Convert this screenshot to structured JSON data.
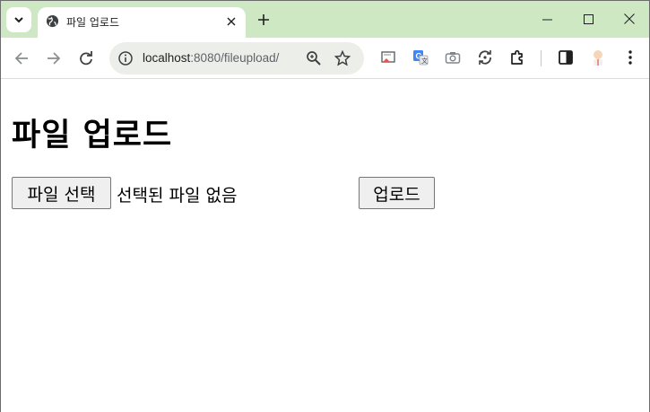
{
  "window": {
    "tab_title": "파일 업로드",
    "new_tab_glyph": "+",
    "frame_color": "#cfe8c4"
  },
  "toolbar": {
    "url_host": "localhost",
    "url_path": ":8080/fileupload/",
    "icons": [
      "back-icon",
      "forward-icon",
      "reload-icon",
      "info-icon",
      "zoom-icon",
      "star-icon",
      "cast-icon",
      "translate-icon",
      "camera-icon",
      "sync-icon",
      "extensions-icon",
      "side-panel-icon",
      "profile-avatar",
      "kebab-menu-icon"
    ]
  },
  "page": {
    "heading": "파일 업로드",
    "choose_file_label": "파일 선택",
    "file_status": "선택된 파일 없음",
    "upload_label": "업로드"
  }
}
